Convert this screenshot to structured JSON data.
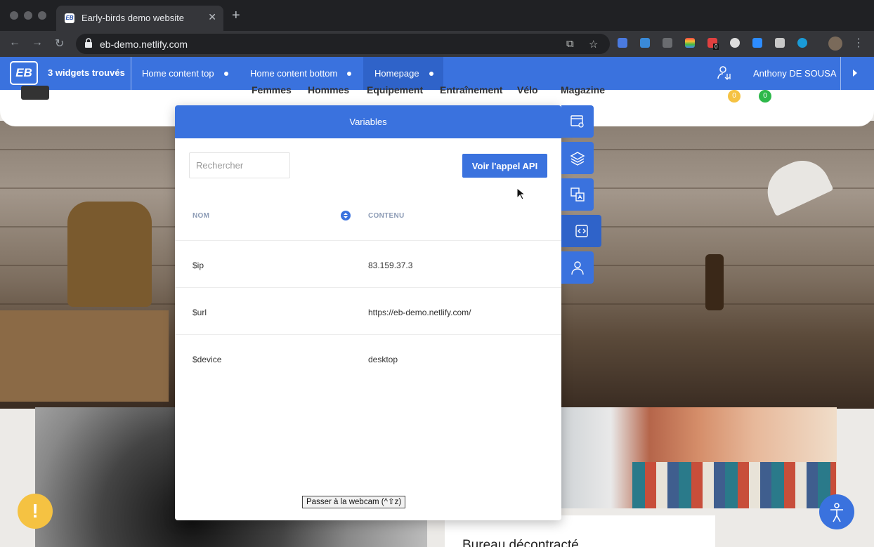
{
  "browser": {
    "tab_title": "Early-birds demo website",
    "tab_favicon": "EB",
    "url": "eb-demo.netlify.com",
    "extension_badge": "0"
  },
  "eb_bar": {
    "logo": "EB",
    "widget_count": "3 widgets trouvés",
    "tabs": [
      {
        "label": "Home content top"
      },
      {
        "label": "Home content bottom"
      },
      {
        "label": "Homepage"
      }
    ],
    "user_name": "Anthony DE SOUSA"
  },
  "site": {
    "nav": [
      "Femmes",
      "Hommes",
      "Equipement",
      "Entraînement",
      "Vélo",
      "Magazine"
    ],
    "cart_badge_1": "0",
    "cart_badge_2": "0",
    "card_title": "Bureau décontracté",
    "warn_label": "!"
  },
  "panel": {
    "title": "Variables",
    "search_placeholder": "Rechercher",
    "api_button": "Voir l'appel API",
    "columns": {
      "name": "NOM",
      "content": "CONTENU"
    },
    "rows": [
      {
        "name": "$ip",
        "content": "83.159.37.3"
      },
      {
        "name": "$url",
        "content": "https://eb-demo.netlify.com/"
      },
      {
        "name": "$device",
        "content": "desktop"
      }
    ]
  },
  "webcam_tooltip": "Passer à la webcam (^⇧z)",
  "colors": {
    "eb_blue": "#3a72de",
    "eb_blue_active": "#2f63c9",
    "warn_yellow": "#f5c242",
    "badge_yellow": "#f5c242",
    "badge_green": "#2db84a"
  },
  "icons": {
    "side_toolbar": [
      "widget-edit-icon",
      "layers-icon",
      "translate-icon",
      "code-icon",
      "user-icon"
    ]
  }
}
